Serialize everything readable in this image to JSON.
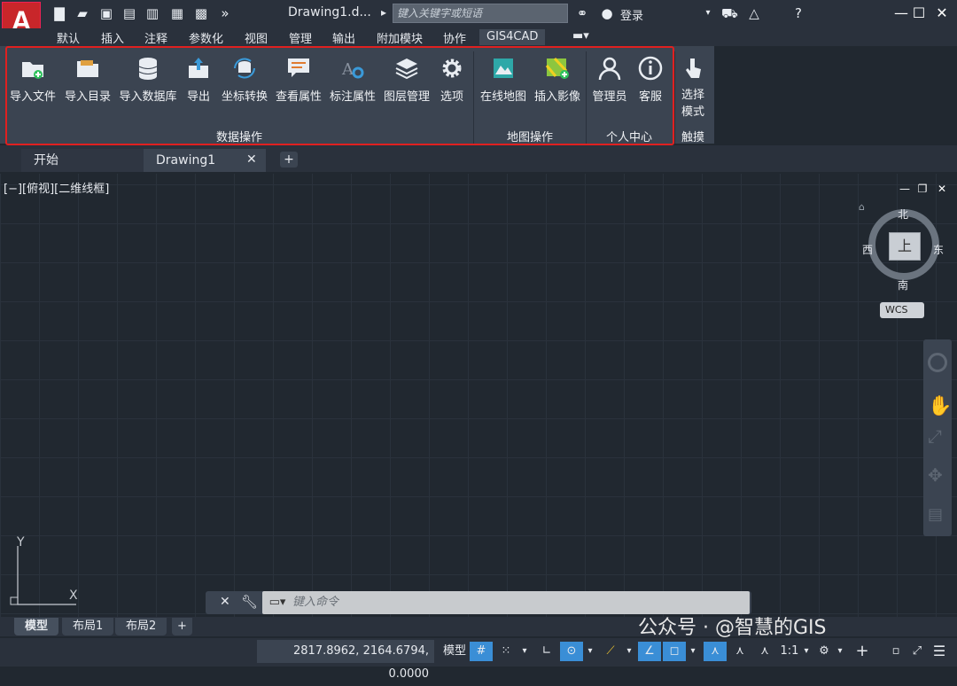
{
  "title_bar": {
    "app_logo": "A",
    "doc_title": "Drawing1.d...",
    "search_placeholder": "键入关键字或短语",
    "login_label": "登录"
  },
  "menu_tabs": [
    "默认",
    "插入",
    "注释",
    "参数化",
    "视图",
    "管理",
    "输出",
    "附加模块",
    "协作",
    "GIS4CAD"
  ],
  "ribbon": {
    "data_ops": {
      "title": "数据操作",
      "buttons": [
        "导入文件",
        "导入目录",
        "导入数据库",
        "导出",
        "坐标转换",
        "查看属性",
        "标注属性",
        "图层管理",
        "选项"
      ]
    },
    "map_ops": {
      "title": "地图操作",
      "buttons": [
        "在线地图",
        "插入影像"
      ]
    },
    "personal": {
      "title": "个人中心",
      "buttons": [
        "管理员",
        "客服"
      ]
    },
    "touch": {
      "title": "触摸",
      "button_line1": "选择",
      "button_line2": "模式"
    }
  },
  "doc_tabs": {
    "start": "开始",
    "drawing": "Drawing1",
    "close": "✕",
    "add": "+"
  },
  "viewport": {
    "label": "[−][俯视][二维线框]",
    "viewcube": {
      "north": "北",
      "south": "南",
      "east": "东",
      "west": "西",
      "top": "上",
      "wcs": "WCS"
    },
    "axis_y": "Y",
    "axis_x": "X"
  },
  "command_line": {
    "placeholder": "键入命令"
  },
  "layout_tabs": [
    "模型",
    "布局1",
    "布局2"
  ],
  "status_bar": {
    "coordinates": "2817.8962, 2164.6794, 0.0000",
    "model": "模型",
    "scale": "1:1"
  },
  "watermark": "公众号 · @智慧的GIS"
}
